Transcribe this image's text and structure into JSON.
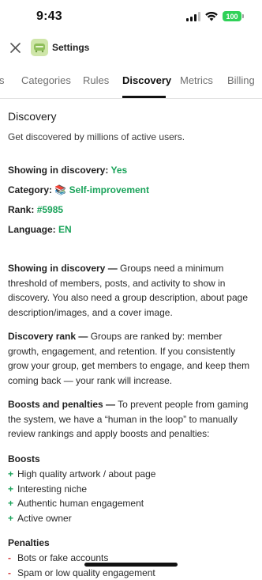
{
  "status_bar": {
    "time": "9:43",
    "battery": "100",
    "icons": [
      "signal-icon",
      "wifi-icon",
      "battery-icon"
    ]
  },
  "header": {
    "title": "Settings",
    "close_icon": "close-icon",
    "app_icon": "app-icon"
  },
  "tabs": [
    {
      "label": "s"
    },
    {
      "label": "Categories"
    },
    {
      "label": "Rules"
    },
    {
      "label": "Discovery",
      "active": true
    },
    {
      "label": "Metrics"
    },
    {
      "label": "Billing"
    }
  ],
  "discovery": {
    "title": "Discovery",
    "subtitle": "Get discovered by millions of active users.",
    "showing_label": "Showing in discovery:",
    "showing_value": "Yes",
    "category_label": "Category:",
    "category_emoji": "📚",
    "category_value": "Self-improvement",
    "rank_label": "Rank:",
    "rank_value": "#5985",
    "language_label": "Language:",
    "language_value": "EN"
  },
  "info": {
    "showing_heading": "Showing in discovery —",
    "showing_text": " Groups need a minimum threshold of members, posts, and activity to show in discovery. You also need a group description, about page description/images, and a cover image.",
    "rank_heading": "Discovery rank —",
    "rank_text": " Groups are ranked by: member growth, engagement, and retention. If you consistently grow your group, get members to engage, and keep them coming back — your rank will increase.",
    "boosts_heading": "Boosts and penalties —",
    "boosts_text": " To prevent people from gaming the system, we have a “human in the loop” to manually review rankings and apply boosts and penalties:"
  },
  "boosts": {
    "heading": "Boosts",
    "items": [
      "High quality artwork / about page",
      "Interesting niche",
      "Authentic human engagement",
      "Active owner"
    ]
  },
  "penalties": {
    "heading": "Penalties",
    "items": [
      "Bots or fake accounts",
      "Spam or low quality engagement"
    ]
  },
  "colors": {
    "accent_green": "#1aa35a",
    "penalty_red": "#d23a3a",
    "battery_green": "#2fd158"
  }
}
